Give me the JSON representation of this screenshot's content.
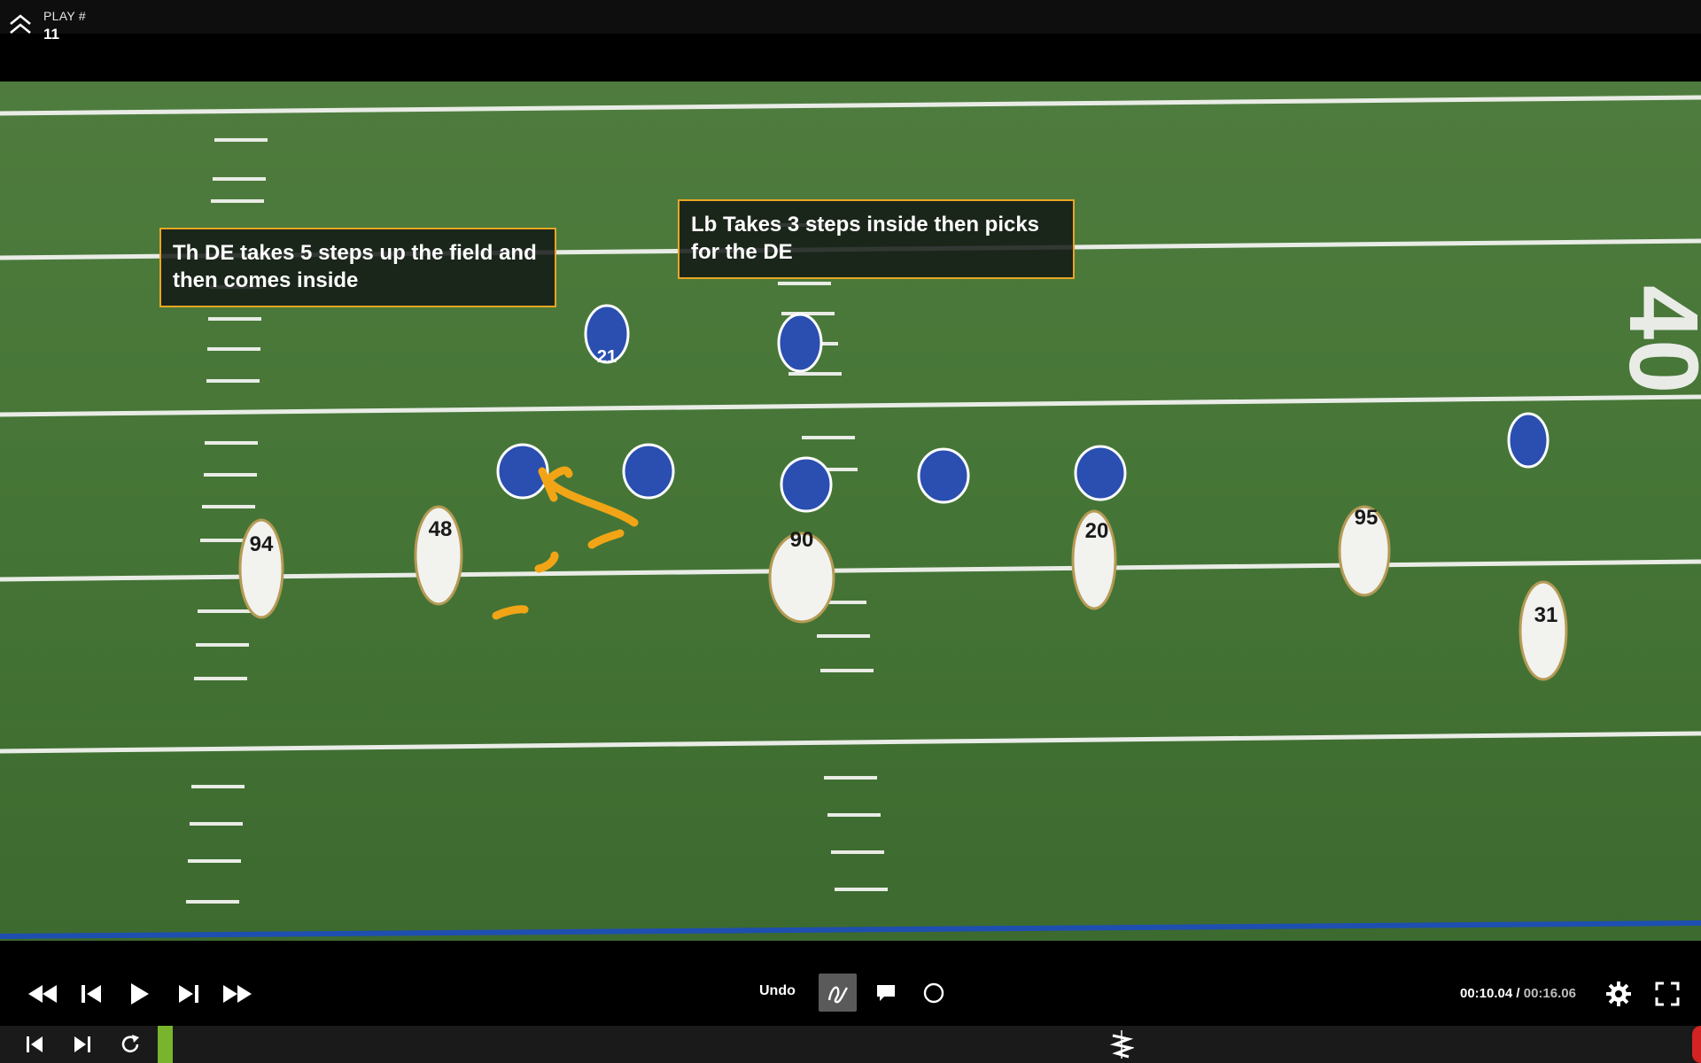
{
  "header": {
    "play_label": "PLAY #",
    "play_number": "11",
    "collapse_icon": "chevron-double-up-icon"
  },
  "annotations": {
    "note_de": "Th DE takes 5 steps up the field and then comes inside",
    "note_lb": "Lb Takes 3 steps inside then picks for the DE",
    "accent_color": "#e8a623"
  },
  "controls": {
    "undo_label": "Undo",
    "current_time": "00:10.04",
    "separator": " / ",
    "total_time": "00:16.06",
    "progress_fraction": 0.009,
    "icons": [
      "rewind-icon",
      "step-back-icon",
      "play-icon",
      "step-forward-icon",
      "fast-forward-icon",
      "freehand-draw-icon",
      "comment-icon",
      "circle-icon",
      "gear-icon",
      "fullscreen-icon",
      "skip-start-icon",
      "skip-end-icon",
      "replay-icon",
      "zigzag-marker-icon"
    ]
  },
  "field": {
    "jersey_numbers": [
      "94",
      "48",
      "90",
      "20",
      "95",
      "31",
      "21"
    ],
    "yard_numbers": [
      "40"
    ]
  }
}
